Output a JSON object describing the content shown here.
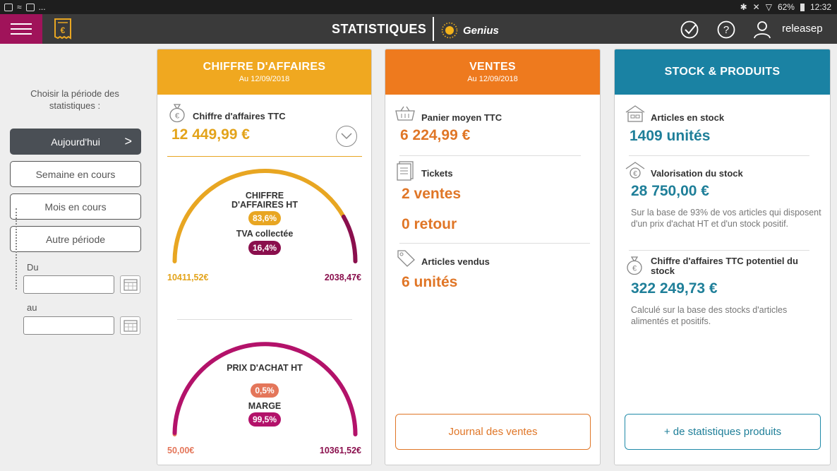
{
  "statusbar": {
    "battery": "62%",
    "time": "12:32",
    "more": "..."
  },
  "header": {
    "title": "STATISTIQUES",
    "brand": "Genius",
    "user": "releasep"
  },
  "sidebar": {
    "label": "Choisir la période des statistiques :",
    "buttons": [
      "Aujourd'hui",
      "Semaine en cours",
      "Mois en cours",
      "Autre période"
    ],
    "chevron": ">",
    "from_label": "Du",
    "to_label": "au",
    "from_value": "",
    "to_value": ""
  },
  "colors": {
    "brand_magenta": "#a0135a",
    "ca_header": "#f0a820",
    "ventes_header": "#ee7a1e",
    "stock_header": "#1a82a3",
    "value_orange": "#e07627",
    "value_teal": "#1f7f99",
    "gauge_gold": "#e8a622",
    "gauge_plum": "#8a0f4d",
    "gauge_magenta": "#b3126a",
    "gauge_salmon": "#e4765a"
  },
  "ca": {
    "header_title": "CHIFFRE D'AFFAIRES",
    "header_date": "Au 12/09/2018",
    "ttc_label": "Chiffre d'affaires TTC",
    "ttc_value": "12 449,99 €",
    "gauge1": {
      "label1": "CHIFFRE D'AFFAIRES HT",
      "pct1": "83,6%",
      "label2": "TVA collectée",
      "pct2": "16,4%",
      "left_value": "10411,52€",
      "right_value": "2038,47€",
      "fraction": 0.836
    },
    "gauge2": {
      "label1": "PRIX D'ACHAT HT",
      "pct1": "0,5%",
      "label2": "MARGE",
      "pct2": "99,5%",
      "left_value": "50,00€",
      "right_value": "10361,52€",
      "fraction": 0.005
    }
  },
  "ventes": {
    "header_title": "VENTES",
    "header_date": "Au 12/09/2018",
    "panier_label": "Panier moyen TTC",
    "panier_value": "6 224,99 €",
    "tickets_label": "Tickets",
    "tickets_sales": "2 ventes",
    "tickets_returns": "0 retour",
    "articles_label": "Articles vendus",
    "articles_value": "6 unités",
    "journal_button": "Journal des ventes"
  },
  "stock": {
    "header_title": "STOCK & PRODUITS",
    "articles_label": "Articles en stock",
    "articles_value": "1409 unités",
    "valo_label": "Valorisation du stock",
    "valo_value": "28 750,00 €",
    "valo_note": "Sur la base de 93% de vos articles qui disposent d'un prix d'achat HT et d'un stock positif.",
    "potentiel_label": "Chiffre d'affaires TTC potentiel du stock",
    "potentiel_value": "322 249,73 €",
    "potentiel_note": "Calculé sur la base des stocks d'articles alimentés et positifs.",
    "stats_button": "+ de statistiques produits"
  }
}
